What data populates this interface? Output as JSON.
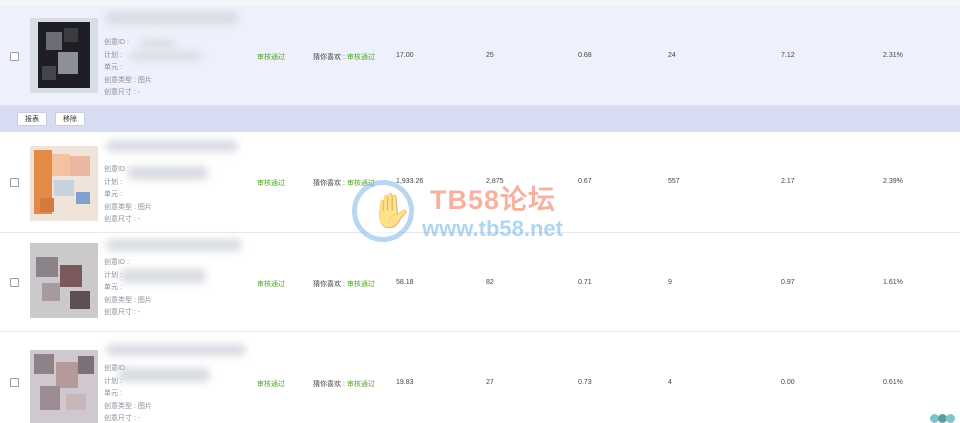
{
  "labels": {
    "idea_id": "创意ID :",
    "plan": "计划 :",
    "unit": "单元 :",
    "type": "创意类型 : 图片",
    "size": "创意尺寸 : -"
  },
  "action_bar": {
    "report": "报表",
    "remove": "移除"
  },
  "watermark": {
    "title": "TB58论坛",
    "url": "www.tb58.net"
  },
  "rows": [
    {
      "status": "审核通过",
      "placement_prefix": "猜你喜欢 : ",
      "placement_status": "审核通过",
      "spend": "17.00",
      "clicks": "25",
      "ctr_cost": "0.68",
      "orders": "24",
      "roi": "7.12",
      "rate": "2.31%"
    },
    {
      "status": "审核通过",
      "placement_prefix": "猜你喜欢 : ",
      "placement_status": "审核通过",
      "spend": "1,933.26",
      "clicks": "2,875",
      "ctr_cost": "0.67",
      "orders": "557",
      "roi": "2.17",
      "rate": "2.39%"
    },
    {
      "status": "审核通过",
      "placement_prefix": "猜你喜欢 : ",
      "placement_status": "审核通过",
      "spend": "58.18",
      "clicks": "82",
      "ctr_cost": "0.71",
      "orders": "9",
      "roi": "0.97",
      "rate": "1.61%"
    },
    {
      "status": "审核通过",
      "placement_prefix": "猜你喜欢 : ",
      "placement_status": "审核通过",
      "spend": "19.83",
      "clicks": "27",
      "ctr_cost": "0.73",
      "orders": "4",
      "roi": "0.00",
      "rate": "0.61%"
    }
  ]
}
